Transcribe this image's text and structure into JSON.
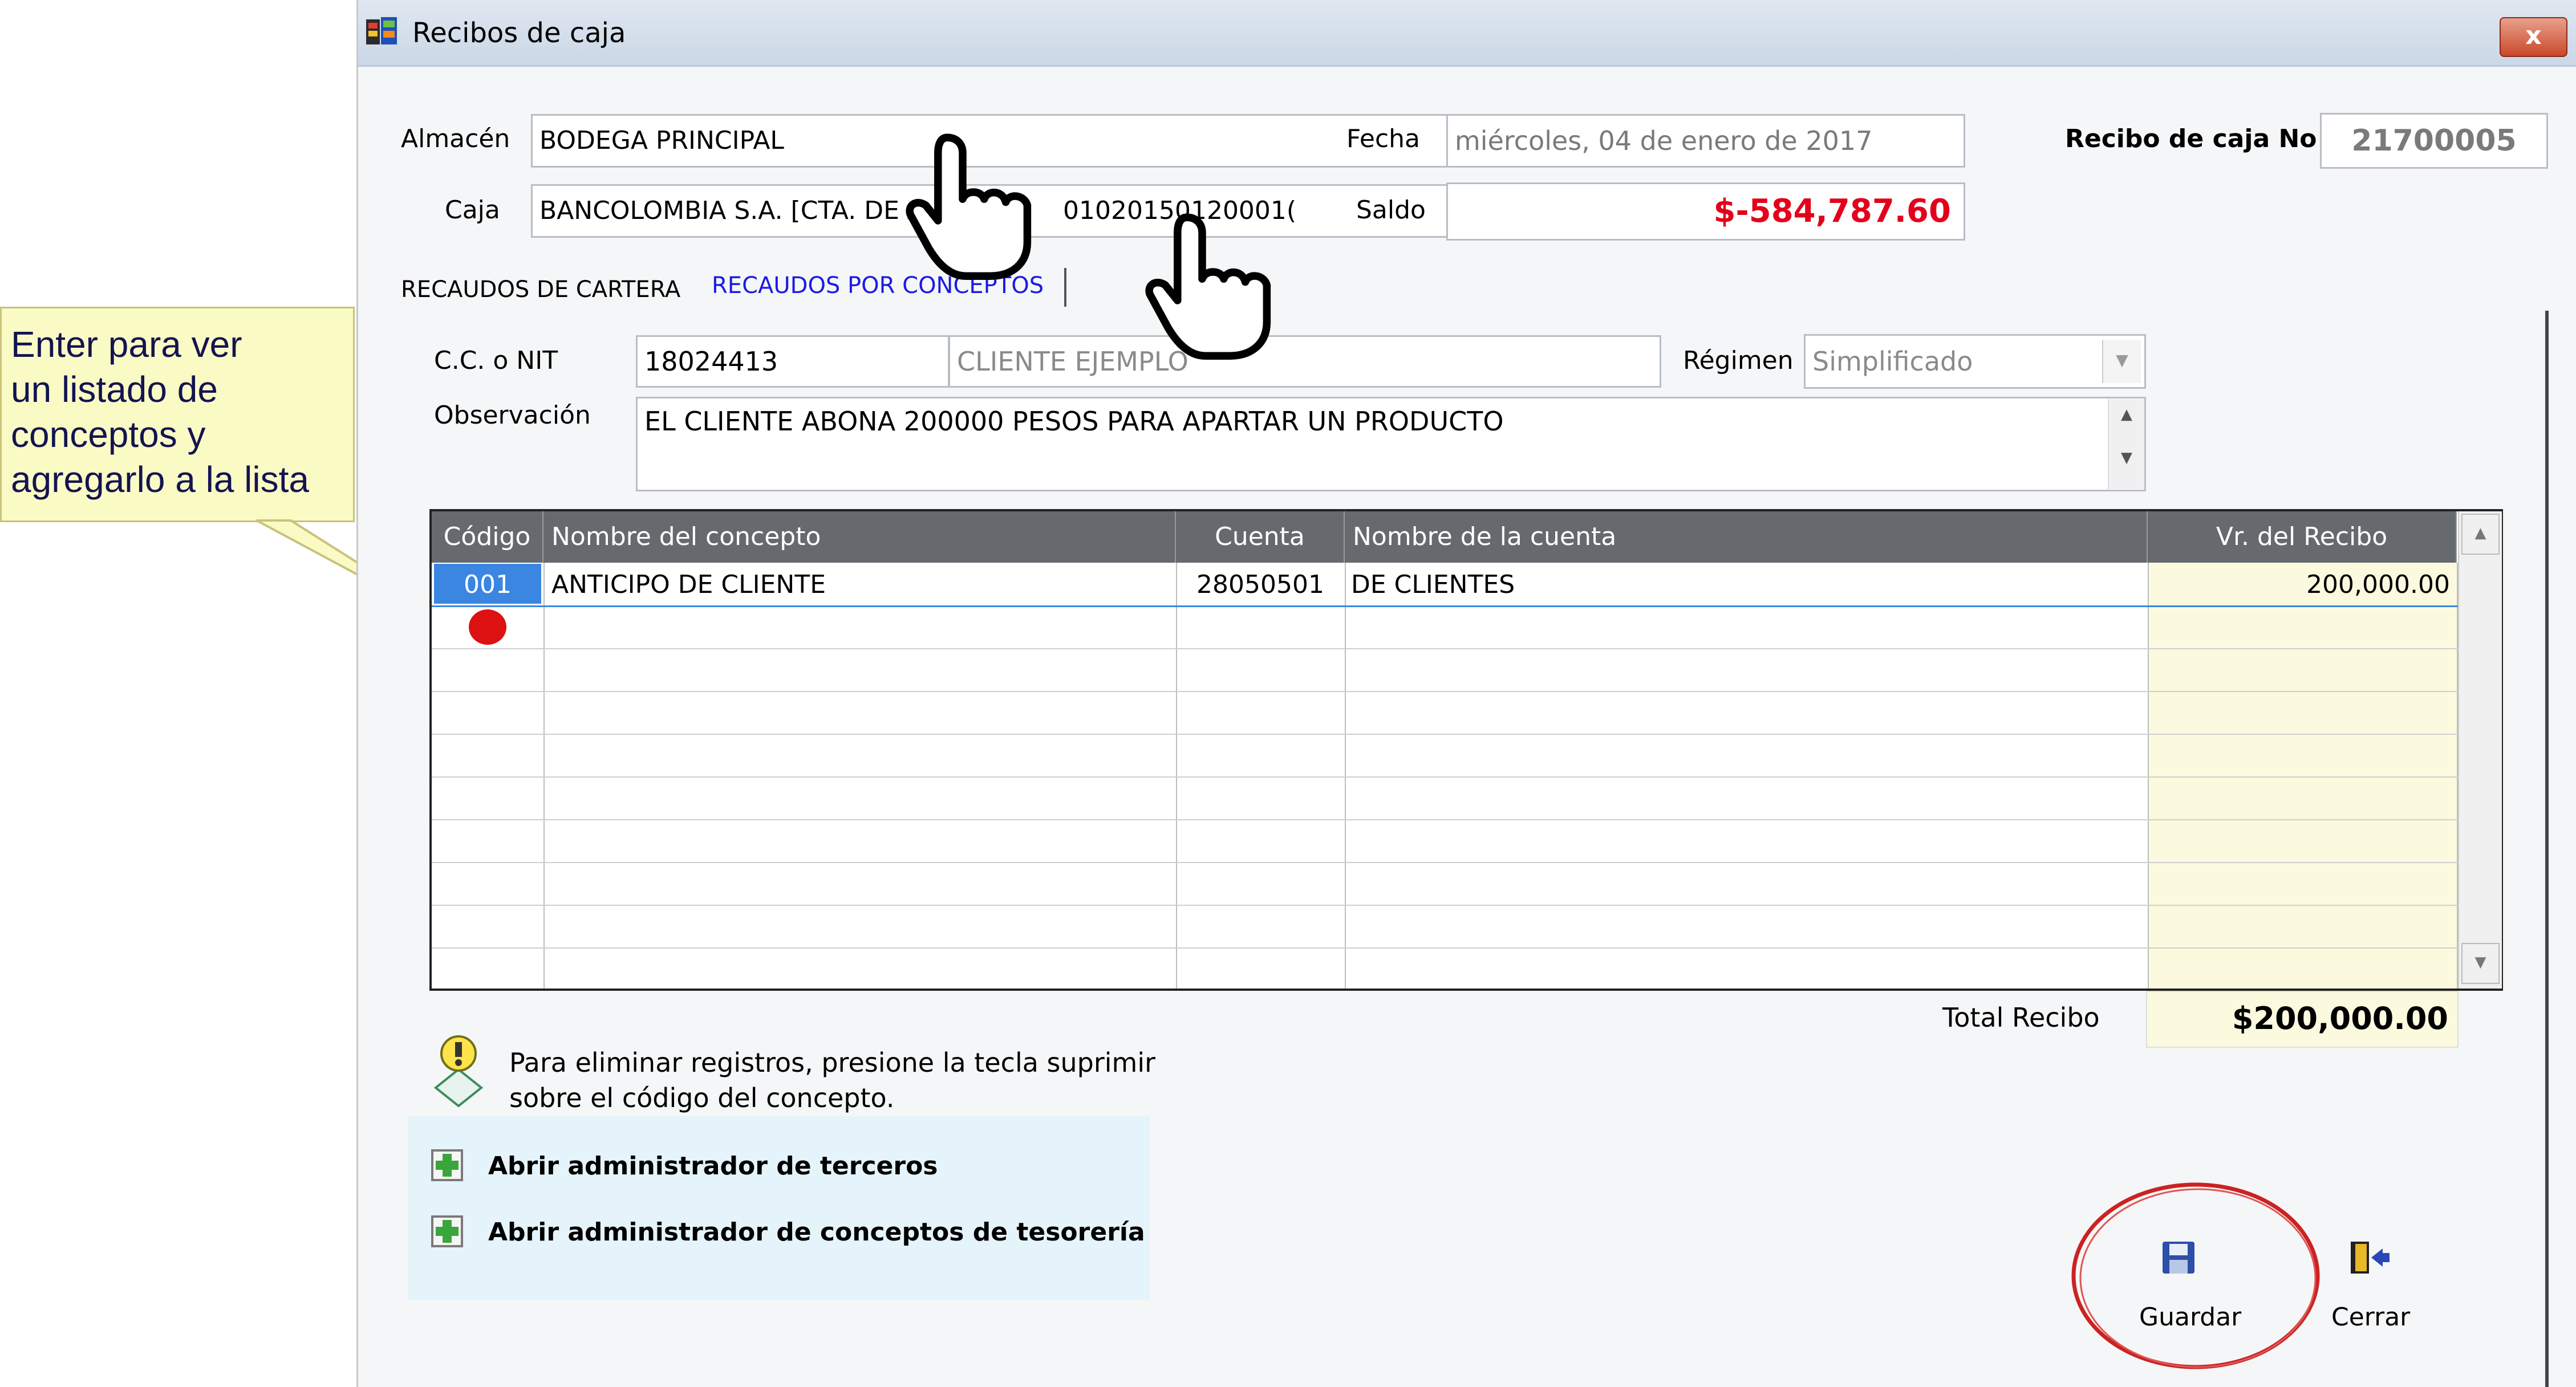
{
  "window": {
    "title": "Recibos de caja",
    "close_label": "x"
  },
  "form": {
    "almacen_label": "Almacén",
    "almacen_value": "BODEGA PRINCIPAL",
    "caja_label": "Caja",
    "caja_value": "BANCOLOMBIA S.A. [CTA. DE A",
    "caja_value_tail": "01020150120001(",
    "fecha_label": "Fecha",
    "fecha_value": "miércoles, 04 de enero de 2017",
    "saldo_label": "Saldo",
    "saldo_value": "$-584,787.60",
    "recibo_label": "Recibo de caja No",
    "recibo_value": "21700005",
    "ccnit_label": "C.C. o NIT",
    "ccnit_value": "18024413",
    "cliente_value": "CLIENTE EJEMPLO",
    "regimen_label": "Régimen",
    "regimen_value": "Simplificado",
    "observacion_label": "Observación",
    "observacion_value": "EL CLIENTE ABONA 200000 PESOS PARA APARTAR UN PRODUCTO"
  },
  "tabs": [
    {
      "label": "RECAUDOS DE CARTERA",
      "active": false
    },
    {
      "label": "RECAUDOS POR CONCEPTOS",
      "active": true
    }
  ],
  "grid": {
    "columns": [
      "Código",
      "Nombre del concepto",
      "Cuenta",
      "Nombre de la cuenta",
      "Vr. del Recibo"
    ],
    "rows": [
      {
        "codigo": "001",
        "concepto": "ANTICIPO DE CLIENTE",
        "cuenta": "28050501",
        "nombre_cuenta": "DE CLIENTES",
        "valor": "200,000.00"
      }
    ]
  },
  "totals": {
    "label": "Total Recibo",
    "value": "$200,000.00"
  },
  "hint": {
    "line1": "Para eliminar registros, presione la tecla suprimir",
    "line2": "sobre el código del concepto."
  },
  "links": [
    {
      "label": "Abrir administrador de terceros"
    },
    {
      "label": "Abrir administrador de conceptos de tesorería"
    }
  ],
  "buttons": {
    "guardar": "Guardar",
    "cerrar": "Cerrar"
  },
  "tooltip": {
    "line1": "Enter para ver",
    "line2": "un listado de",
    "line3": "conceptos y",
    "line4": "agregarlo a la lista"
  },
  "colors": {
    "saldo_negative": "#e3001b",
    "tab_active": "#1a1ae6",
    "grid_header": "#666a6e",
    "amount_column": "#fbfadf",
    "selected_cell": "#3a86e0",
    "marker_dot": "#dd1111",
    "guardar_circle": "#cc2222"
  }
}
